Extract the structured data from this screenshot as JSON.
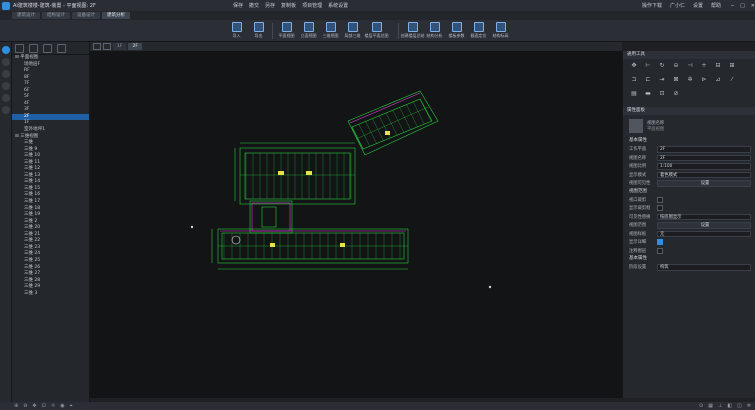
{
  "title": "AI建筑楼楼-建筑-装置 - 平面视图: 2F",
  "quick_actions": [
    "保存",
    "撤交",
    "另存",
    "复制板",
    "项目管理",
    "系统设置"
  ],
  "top_right": [
    "操作下载",
    "广小仁",
    "设置",
    "帮助"
  ],
  "menu_tabs": [
    "建筑设计",
    "结构设计",
    "设备设计",
    "建筑分析"
  ],
  "active_menu_tab": 3,
  "ribbon": [
    {
      "label": "导入"
    },
    {
      "label": "导出"
    },
    {
      "label": "平面视图"
    },
    {
      "label": "立面视图"
    },
    {
      "label": "三维视图"
    },
    {
      "label": "局部三维"
    },
    {
      "label": "楼层平面总图"
    },
    {
      "label": "创建楼层总结"
    },
    {
      "label": "结构分析"
    },
    {
      "label": "楼板参数"
    },
    {
      "label": "截面定位"
    },
    {
      "label": "结构标高"
    }
  ],
  "tree": {
    "items": [
      {
        "label": "平面视图",
        "level": 0,
        "expander": "−"
      },
      {
        "label": "场地层F",
        "level": 1
      },
      {
        "label": "RF",
        "level": 1
      },
      {
        "label": "8F",
        "level": 1
      },
      {
        "label": "7F",
        "level": 1
      },
      {
        "label": "6F",
        "level": 1
      },
      {
        "label": "5F",
        "level": 1
      },
      {
        "label": "4F",
        "level": 1
      },
      {
        "label": "3F",
        "level": 1
      },
      {
        "label": "2F",
        "level": 1,
        "selected": true
      },
      {
        "label": "1F",
        "level": 1
      },
      {
        "label": "室外地坪1",
        "level": 1
      },
      {
        "label": "三维视图",
        "level": 0,
        "expander": "−"
      },
      {
        "label": "三维",
        "level": 1
      },
      {
        "label": "三维 9",
        "level": 1
      },
      {
        "label": "三维 10",
        "level": 1
      },
      {
        "label": "三维 11",
        "level": 1
      },
      {
        "label": "三维 12",
        "level": 1
      },
      {
        "label": "三维 13",
        "level": 1
      },
      {
        "label": "三维 14",
        "level": 1
      },
      {
        "label": "三维 15",
        "level": 1
      },
      {
        "label": "三维 16",
        "level": 1
      },
      {
        "label": "三维 17",
        "level": 1
      },
      {
        "label": "三维 18",
        "level": 1
      },
      {
        "label": "三维 19",
        "level": 1
      },
      {
        "label": "三维 2",
        "level": 1
      },
      {
        "label": "三维 20",
        "level": 1
      },
      {
        "label": "三维 21",
        "level": 1
      },
      {
        "label": "三维 22",
        "level": 1
      },
      {
        "label": "三维 23",
        "level": 1
      },
      {
        "label": "三维 24",
        "level": 1
      },
      {
        "label": "三维 25",
        "level": 1
      },
      {
        "label": "三维 26",
        "level": 1
      },
      {
        "label": "三维 27",
        "level": 1
      },
      {
        "label": "三维 28",
        "level": 1
      },
      {
        "label": "三维 29",
        "level": 1
      },
      {
        "label": "三维 3",
        "level": 1
      }
    ]
  },
  "view_tabs": [
    "1F",
    "2F"
  ],
  "active_view_tab": 1,
  "right_panel": {
    "tools_header": "通用工具",
    "prop_header": "属性面板",
    "view_name": "视图名称",
    "view_name_sub": "平面视图",
    "sections": {
      "basic": "基本属性",
      "range": "视图范围",
      "other": "基本属性"
    },
    "rows": [
      {
        "label": "工作平面",
        "value": "2F"
      },
      {
        "label": "视图名称",
        "value": "2F"
      },
      {
        "label": "视图比例",
        "value": "1:100"
      },
      {
        "label": "显示模式",
        "value": "着色模式"
      },
      {
        "label": "视图可见性",
        "value": "设置"
      }
    ],
    "range_rows": [
      {
        "label": "视口裁剪",
        "type": "check",
        "checked": false
      },
      {
        "label": "显示裁剪框",
        "type": "check",
        "checked": false
      },
      {
        "label": "可见性替换",
        "value": "按底图显示"
      },
      {
        "label": "视图范围",
        "value": "设置"
      },
      {
        "label": "视图样板",
        "value": "无"
      },
      {
        "label": "显示详细",
        "type": "check",
        "checked": true
      },
      {
        "label": "注释图层",
        "type": "check",
        "checked": false
      }
    ],
    "other_rows": [
      {
        "label": "阶段设置",
        "value": "构筑"
      }
    ]
  },
  "colors": {
    "accent": "#2f8fe0",
    "cad_green": "#27d13a",
    "cad_magenta": "#e23fe0",
    "cad_yellow": "#e8e24a"
  }
}
